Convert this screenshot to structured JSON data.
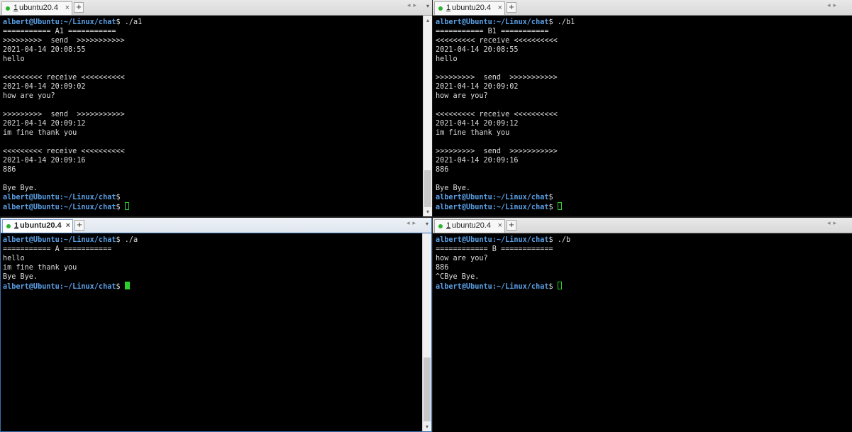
{
  "panes": {
    "top_left": {
      "tab": {
        "number": "1",
        "title": "ubuntu20.4",
        "close": "×"
      },
      "new_tab": "+",
      "lines": [
        {
          "prompt": "albert@Ubuntu:~/Linux/chat",
          "text": "$ ./a1"
        },
        {
          "text": "=========== A1 ==========="
        },
        {
          "text": ">>>>>>>>>  send  >>>>>>>>>>>"
        },
        {
          "text": "2021-04-14 20:08:55"
        },
        {
          "text": "hello"
        },
        {
          "text": ""
        },
        {
          "text": "<<<<<<<<< receive <<<<<<<<<<"
        },
        {
          "text": "2021-04-14 20:09:02"
        },
        {
          "text": "how are you?"
        },
        {
          "text": ""
        },
        {
          "text": ">>>>>>>>>  send  >>>>>>>>>>>"
        },
        {
          "text": "2021-04-14 20:09:12"
        },
        {
          "text": "im fine thank you"
        },
        {
          "text": ""
        },
        {
          "text": "<<<<<<<<< receive <<<<<<<<<<"
        },
        {
          "text": "2021-04-14 20:09:16"
        },
        {
          "text": "886"
        },
        {
          "text": ""
        },
        {
          "text": "Bye Bye."
        },
        {
          "prompt": "albert@Ubuntu:~/Linux/chat",
          "text": "$"
        },
        {
          "prompt": "albert@Ubuntu:~/Linux/chat",
          "text": "$ ",
          "cursor": "hollow"
        }
      ]
    },
    "top_right": {
      "tab": {
        "number": "1",
        "title": "ubuntu20.4",
        "close": "×"
      },
      "new_tab": "+",
      "lines": [
        {
          "prompt": "albert@Ubuntu:~/Linux/chat",
          "text": "$ ./b1"
        },
        {
          "text": "=========== B1 ==========="
        },
        {
          "text": "<<<<<<<<< receive <<<<<<<<<<"
        },
        {
          "text": "2021-04-14 20:08:55"
        },
        {
          "text": "hello"
        },
        {
          "text": ""
        },
        {
          "text": ">>>>>>>>>  send  >>>>>>>>>>>"
        },
        {
          "text": "2021-04-14 20:09:02"
        },
        {
          "text": "how are you?"
        },
        {
          "text": ""
        },
        {
          "text": "<<<<<<<<< receive <<<<<<<<<<"
        },
        {
          "text": "2021-04-14 20:09:12"
        },
        {
          "text": "im fine thank you"
        },
        {
          "text": ""
        },
        {
          "text": ">>>>>>>>>  send  >>>>>>>>>>>"
        },
        {
          "text": "2021-04-14 20:09:16"
        },
        {
          "text": "886"
        },
        {
          "text": ""
        },
        {
          "text": "Bye Bye."
        },
        {
          "prompt": "albert@Ubuntu:~/Linux/chat",
          "text": "$"
        },
        {
          "prompt": "albert@Ubuntu:~/Linux/chat",
          "text": "$ ",
          "cursor": "hollow"
        }
      ]
    },
    "bottom_left": {
      "tab": {
        "number": "1",
        "title": "ubuntu20.4",
        "close": "×"
      },
      "new_tab": "+",
      "lines": [
        {
          "prompt": "albert@Ubuntu:~/Linux/chat",
          "text": "$ ./a"
        },
        {
          "text": "=========== A ==========="
        },
        {
          "text": "hello"
        },
        {
          "text": "im fine thank you"
        },
        {
          "text": "Bye Bye."
        },
        {
          "prompt": "albert@Ubuntu:~/Linux/chat",
          "text": "$ ",
          "cursor": "block"
        }
      ]
    },
    "bottom_right": {
      "tab": {
        "number": "1",
        "title": "ubuntu20.4",
        "close": "×"
      },
      "new_tab": "+",
      "lines": [
        {
          "prompt": "albert@Ubuntu:~/Linux/chat",
          "text": "$ ./b"
        },
        {
          "text": "============ B ============"
        },
        {
          "text": "how are you?"
        },
        {
          "text": "886"
        },
        {
          "text": "^CBye Bye."
        },
        {
          "prompt": "albert@Ubuntu:~/Linux/chat",
          "text": "$ ",
          "cursor": "hollow"
        }
      ]
    }
  },
  "colors": {
    "prompt": "#5aa0e6",
    "output": "#dcdcdc",
    "cursor": "#29d129",
    "background": "#000000",
    "active_border": "#3a6fb0"
  },
  "icons": {
    "tab_status": "green-dot-icon",
    "nav_prev": "◂",
    "nav_next": "▸",
    "tab_menu": "▾",
    "scroll_up": "▴",
    "scroll_down": "▾"
  }
}
